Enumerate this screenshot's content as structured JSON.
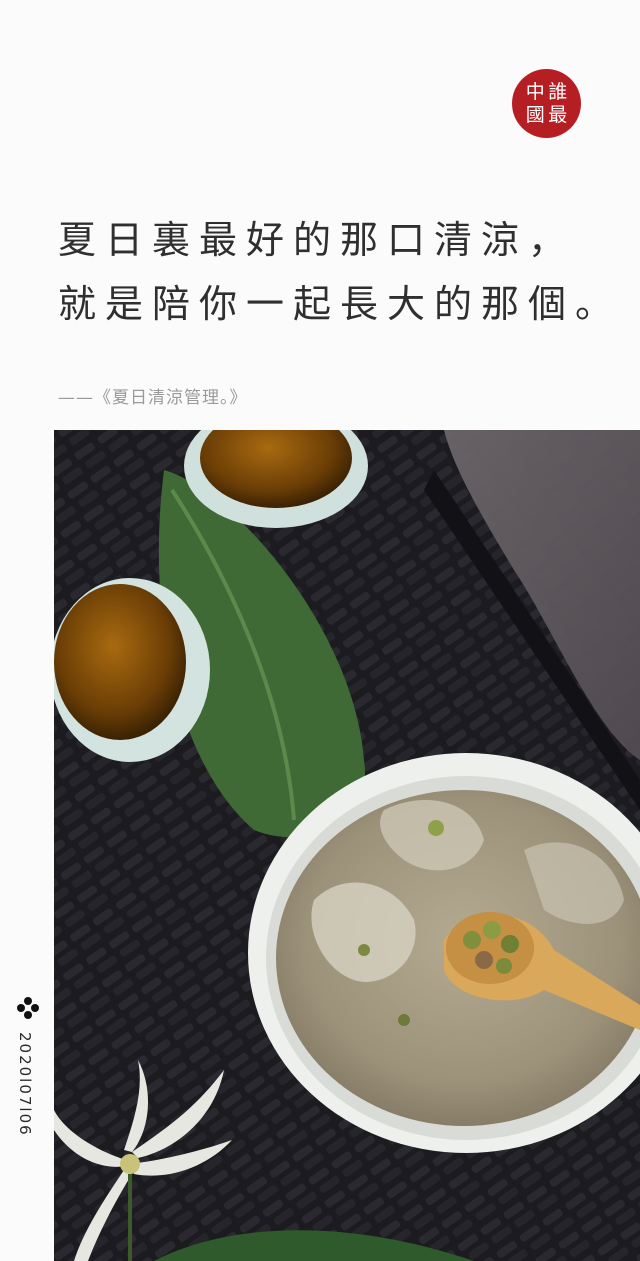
{
  "seal": {
    "chars": [
      "中",
      "誰",
      "國",
      "最"
    ]
  },
  "headline": {
    "line1": "夏日裏最好的那口清涼，",
    "line2": "就是陪你一起長大的那個。"
  },
  "source": "——《夏日清涼管理。》",
  "date": "2020l07l06",
  "colors": {
    "seal": "#b51f24",
    "text": "#2f2f2f",
    "muted": "#9a9a9a"
  }
}
